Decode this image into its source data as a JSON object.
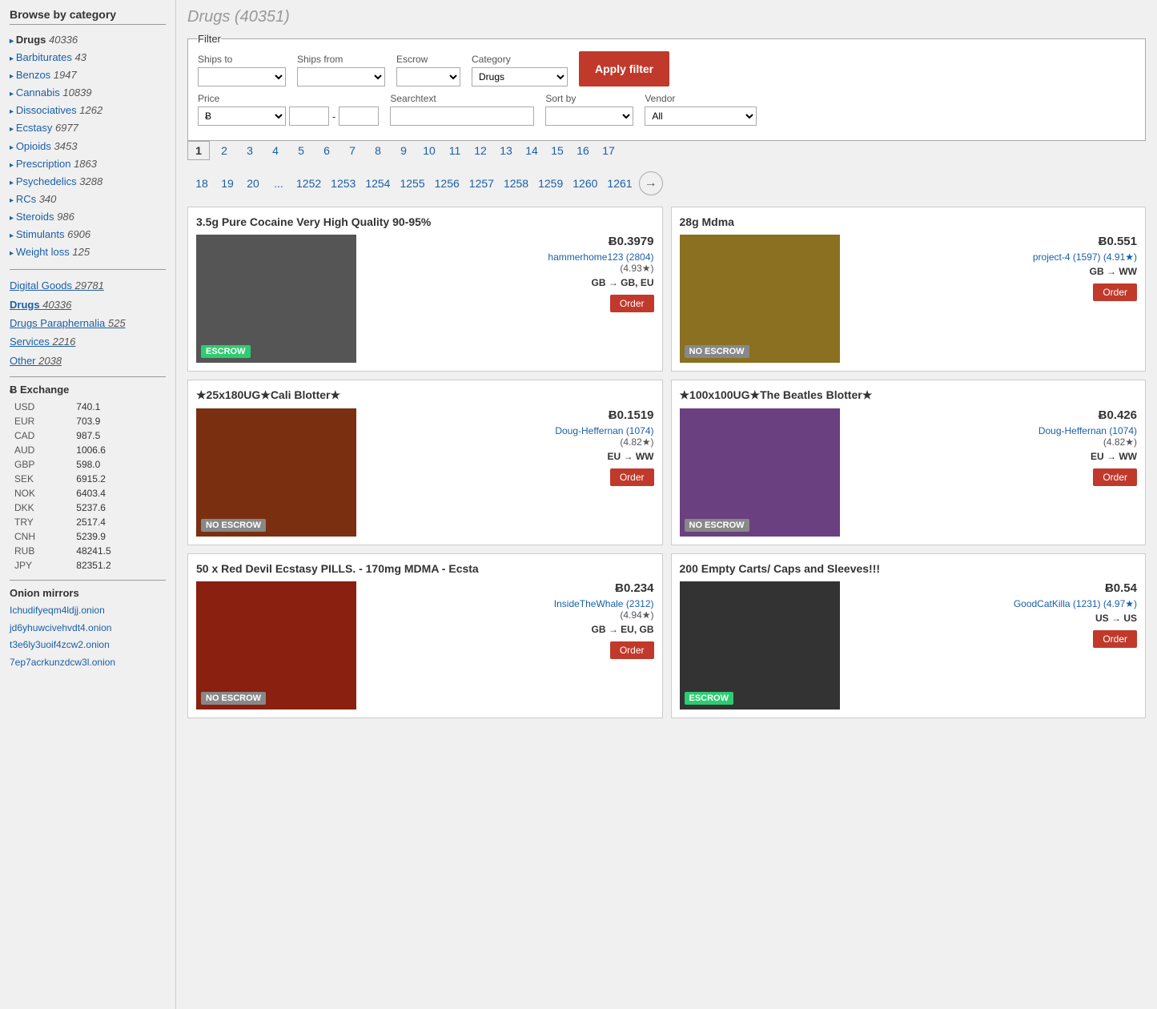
{
  "sidebar": {
    "browse_title": "Browse by category",
    "categories_primary": [
      {
        "label": "Drugs",
        "count": "40336",
        "active": true
      },
      {
        "label": "Barbiturates",
        "count": "43"
      },
      {
        "label": "Benzos",
        "count": "1947"
      },
      {
        "label": "Cannabis",
        "count": "10839"
      },
      {
        "label": "Dissociatives",
        "count": "1262"
      },
      {
        "label": "Ecstasy",
        "count": "6977"
      },
      {
        "label": "Opioids",
        "count": "3453"
      },
      {
        "label": "Prescription",
        "count": "1863"
      },
      {
        "label": "Psychedelics",
        "count": "3288"
      },
      {
        "label": "RCs",
        "count": "340"
      },
      {
        "label": "Steroids",
        "count": "986"
      },
      {
        "label": "Stimulants",
        "count": "6906"
      },
      {
        "label": "Weight loss",
        "count": "125"
      }
    ],
    "categories_secondary": [
      {
        "label": "Digital Goods",
        "count": "29781"
      },
      {
        "label": "Drugs",
        "count": "40336"
      },
      {
        "label": "Drugs Paraphernalia",
        "count": "525"
      },
      {
        "label": "Services",
        "count": "2216"
      },
      {
        "label": "Other",
        "count": "2038"
      }
    ],
    "exchange_title": "Ƀ Exchange",
    "exchange_rates": [
      {
        "currency": "USD",
        "rate": "740.1"
      },
      {
        "currency": "EUR",
        "rate": "703.9"
      },
      {
        "currency": "CAD",
        "rate": "987.5"
      },
      {
        "currency": "AUD",
        "rate": "1006.6"
      },
      {
        "currency": "GBP",
        "rate": "598.0"
      },
      {
        "currency": "SEK",
        "rate": "6915.2"
      },
      {
        "currency": "NOK",
        "rate": "6403.4"
      },
      {
        "currency": "DKK",
        "rate": "5237.6"
      },
      {
        "currency": "TRY",
        "rate": "2517.4"
      },
      {
        "currency": "CNH",
        "rate": "5239.9"
      },
      {
        "currency": "RUB",
        "rate": "48241.5"
      },
      {
        "currency": "JPY",
        "rate": "82351.2"
      }
    ],
    "onion_title": "Onion mirrors",
    "onion_links": [
      "Ichudifyeqm4ldjj.onion",
      "jd6yhuwcivehvdt4.onion",
      "t3e6ly3uoif4zcw2.onion",
      "7ep7acrkunzdcw3l.onion"
    ]
  },
  "main": {
    "page_title": "Drugs (40351)",
    "filter": {
      "legend": "Filter",
      "ships_to_label": "Ships to",
      "ships_from_label": "Ships from",
      "escrow_label": "Escrow",
      "category_label": "Category",
      "category_value": "Drugs",
      "price_label": "Price",
      "searchtext_label": "Searchtext",
      "sort_by_label": "Sort by",
      "vendor_label": "Vendor",
      "vendor_value": "All",
      "apply_button": "Apply filter"
    },
    "pagination_row1": [
      "1",
      "2",
      "3",
      "4",
      "5",
      "6",
      "7",
      "8",
      "9",
      "10",
      "11",
      "12",
      "13",
      "14",
      "15",
      "16",
      "17"
    ],
    "pagination_row2": [
      "18",
      "19",
      "20",
      "...",
      "1252",
      "1253",
      "1254",
      "1255",
      "1256",
      "1257",
      "1258",
      "1259",
      "1260",
      "1261"
    ],
    "products": [
      {
        "title": "3.5g Pure Cocaine Very High Quality 90-95%",
        "price": "Ƀ0.3979",
        "vendor": "hammerhome123 (2804)",
        "rating": "(4.93★)",
        "ships": "GB → GB, EU",
        "escrow": "ESCROW",
        "escrow_type": "escrow",
        "image_bg": "#555",
        "order_label": "Order"
      },
      {
        "title": "28g Mdma",
        "price": "Ƀ0.551",
        "vendor": "project-4 (1597) (4.91★)",
        "rating": "",
        "ships": "GB → WW",
        "escrow": "NO ESCROW",
        "escrow_type": "no-escrow",
        "image_bg": "#8a7020",
        "order_label": "Order"
      },
      {
        "title": "★25x180UG★Cali Blotter★",
        "price": "Ƀ0.1519",
        "vendor": "Doug-Heffernan (1074)",
        "rating": "(4.82★)",
        "ships": "EU → WW",
        "escrow": "NO ESCROW",
        "escrow_type": "no-escrow",
        "image_bg": "#7a3010",
        "order_label": "Order"
      },
      {
        "title": "★100x100UG★The Beatles Blotter★",
        "price": "Ƀ0.426",
        "vendor": "Doug-Heffernan (1074)",
        "rating": "(4.82★)",
        "ships": "EU → WW",
        "escrow": "NO ESCROW",
        "escrow_type": "no-escrow",
        "image_bg": "#6a4080",
        "order_label": "Order"
      },
      {
        "title": "50 x Red Devil Ecstasy PILLS. - 170mg MDMA - Ecsta",
        "price": "Ƀ0.234",
        "vendor": "InsideTheWhale (2312)",
        "rating": "(4.94★)",
        "ships": "GB → EU, GB",
        "escrow": "NO ESCROW",
        "escrow_type": "no-escrow",
        "image_bg": "#8a2010",
        "order_label": "Order"
      },
      {
        "title": "200 Empty Carts/ Caps and Sleeves!!!",
        "price": "Ƀ0.54",
        "vendor": "GoodCatKilla (1231) (4.97★)",
        "rating": "",
        "ships": "US → US",
        "escrow": "ESCROW",
        "escrow_type": "escrow",
        "image_bg": "#333",
        "order_label": "Order"
      }
    ]
  }
}
